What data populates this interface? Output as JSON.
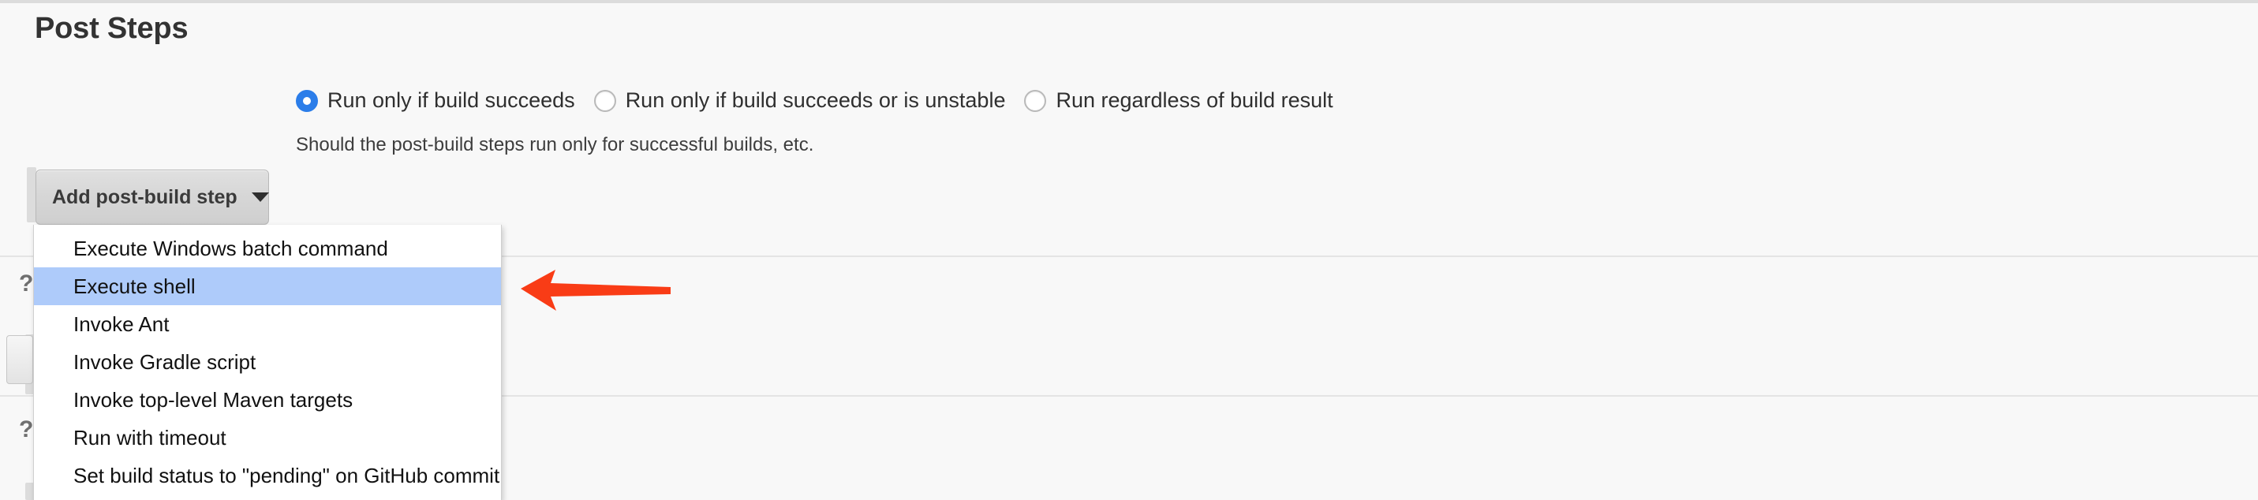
{
  "page": {
    "title": "Post Steps"
  },
  "run_condition": {
    "help_text": "Should the post-build steps run only for successful builds, etc.",
    "options": [
      {
        "label": "Run only if build succeeds",
        "selected": true
      },
      {
        "label": "Run only if build succeeds or is unstable",
        "selected": false
      },
      {
        "label": "Run regardless of build result",
        "selected": false
      }
    ]
  },
  "add_step": {
    "button_label": "Add post-build step",
    "caret_icon": "chevron-down-icon",
    "menu_items": [
      {
        "label": "Execute Windows batch command",
        "highlighted": false
      },
      {
        "label": "Execute shell",
        "highlighted": true
      },
      {
        "label": "Invoke Ant",
        "highlighted": false
      },
      {
        "label": "Invoke Gradle script",
        "highlighted": false
      },
      {
        "label": "Invoke top-level Maven targets",
        "highlighted": false
      },
      {
        "label": "Run with timeout",
        "highlighted": false
      },
      {
        "label": "Set build status to \"pending\" on GitHub commit",
        "highlighted": false
      }
    ]
  },
  "annotation": {
    "arrow_icon": "arrow-left-icon",
    "arrow_color": "#f93c16",
    "points_at": "Execute shell"
  },
  "ghost_help_icons": [
    {
      "glyph": "?"
    },
    {
      "glyph": "?"
    }
  ],
  "colors": {
    "page_background": "#f8f8f8",
    "selected_radio": "#2b7de9",
    "menu_highlight": "#aecbfa",
    "title_text": "#333333"
  }
}
